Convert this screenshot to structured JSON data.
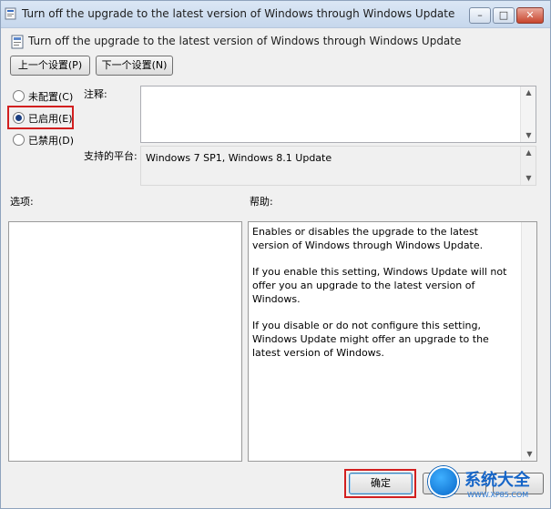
{
  "window": {
    "title": "Turn off the upgrade to the latest version of Windows through Windows Update"
  },
  "header": {
    "policy_name": "Turn off the upgrade to the latest version of Windows through Windows Update"
  },
  "nav": {
    "prev_label": "上一个设置(P)",
    "next_label": "下一个设置(N)"
  },
  "state": {
    "options": [
      {
        "label": "未配置(C)",
        "checked": false
      },
      {
        "label": "已启用(E)",
        "checked": true
      },
      {
        "label": "已禁用(D)",
        "checked": false
      }
    ]
  },
  "comment": {
    "label": "注释:",
    "value": ""
  },
  "platform": {
    "label": "支持的平台:",
    "value": "Windows 7 SP1, Windows 8.1 Update"
  },
  "options_panel": {
    "label": "选项:"
  },
  "help_panel": {
    "label": "帮助:",
    "paragraphs": [
      "Enables or disables the upgrade to the latest version of Windows through Windows Update.",
      "If you enable this setting, Windows Update will not offer you an upgrade to the latest version of Windows.",
      "If you disable or do not configure this setting, Windows Update might offer an upgrade to the latest version of Windows."
    ]
  },
  "footer": {
    "ok_label": "确定"
  },
  "watermark": {
    "title": "系统大全",
    "subtitle": "WWW.XP85.COM"
  },
  "colors": {
    "highlight": "#d21f1f",
    "radio_selected": "#1b3f82"
  }
}
